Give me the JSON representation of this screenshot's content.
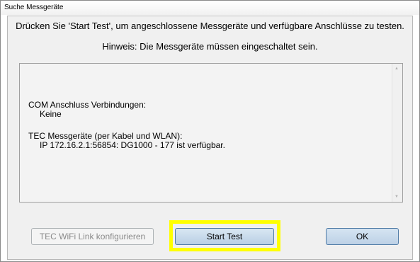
{
  "window": {
    "title": "Suche Messgeräte"
  },
  "instructions": {
    "line1": "Drücken Sie 'Start Test', um angeschlossene Messgeräte und verfügbare Anschlüsse zu testen.",
    "line2": "Hinweis: Die Messgeräte müssen eingeschaltet sein."
  },
  "output": {
    "com_heading": "COM Anschluss Verbindungen:",
    "com_value": "Keine",
    "tec_heading": "TEC Messgeräte (per Kabel und WLAN):",
    "tec_value": "IP 172.16.2.1:56854:  DG1000 - 177 ist verfügbar."
  },
  "buttons": {
    "wifi_label": "TEC WiFi Link konfigurieren",
    "start_label": "Start Test",
    "ok_label": "OK"
  },
  "colors": {
    "highlight": "#ffff00",
    "primary_button_border": "#4f7ba6"
  }
}
